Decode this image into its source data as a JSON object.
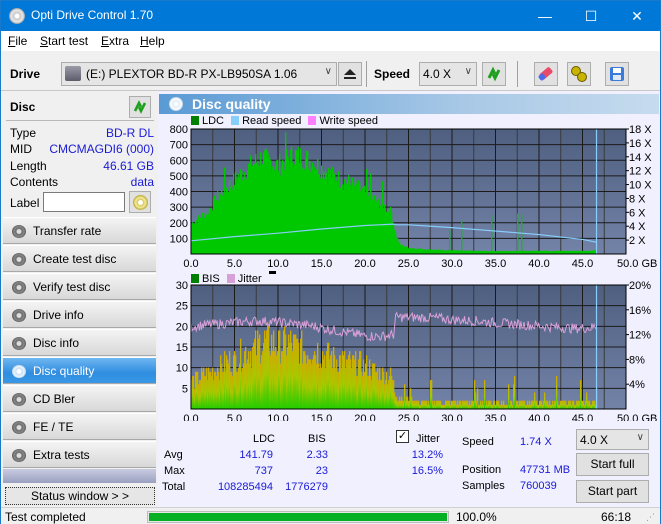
{
  "window": {
    "title": "Opti Drive Control 1.70",
    "minimize": "—",
    "maximize": "☐",
    "close": "✕"
  },
  "menu": [
    {
      "label": "File",
      "accel": "F",
      "rest": "ile"
    },
    {
      "label": "Start test",
      "accel": "S",
      "rest": "tart test"
    },
    {
      "label": "Extra",
      "accel": "E",
      "rest": "xtra"
    },
    {
      "label": "Help",
      "accel": "H",
      "rest": "elp"
    }
  ],
  "toolbar": {
    "drive_label": "Drive",
    "drive_value": "(E:)  PLEXTOR BD-R  PX-LB950SA 1.06",
    "speed_label": "Speed",
    "speed_value": "4.0 X",
    "icons": [
      "drive-icon",
      "eject-icon",
      "refresh-icon",
      "erase-icon",
      "settings-icon",
      "save-icon"
    ]
  },
  "disc": {
    "header": "Disc",
    "rows": [
      {
        "key": "Type",
        "value": "BD-R DL"
      },
      {
        "key": "MID",
        "value": "CMCMAGDI6 (000)"
      },
      {
        "key": "Length",
        "value": "46.61 GB"
      },
      {
        "key": "Contents",
        "value": "data"
      }
    ],
    "label_key": "Label",
    "label_value": ""
  },
  "nav": [
    {
      "label": "Transfer rate",
      "active": false
    },
    {
      "label": "Create test disc",
      "active": false
    },
    {
      "label": "Verify test disc",
      "active": false
    },
    {
      "label": "Drive info",
      "active": false
    },
    {
      "label": "Disc info",
      "active": false
    },
    {
      "label": "Disc quality",
      "active": true
    },
    {
      "label": "CD Bler",
      "active": false
    },
    {
      "label": "FE / TE",
      "active": false
    },
    {
      "label": "Extra tests",
      "active": false
    }
  ],
  "status_window_btn": "Status window > >",
  "panel": {
    "title": "Disc quality"
  },
  "colors": {
    "ldc": "#008000",
    "read_speed": "#87cefa",
    "write_speed": "#ff80ff",
    "bis": "#008000",
    "jitter": "#d8a0d8",
    "plot_bg_top": "#4f5f80",
    "plot_bg_bottom": "#7082a8",
    "bar_green": "#00cc00",
    "bar_yellow": "#c8c000",
    "accent": "#0078d7"
  },
  "chart_data": [
    {
      "type": "bar",
      "title": "",
      "legend": [
        "LDC",
        "Read speed",
        "Write speed"
      ],
      "legend_position": "top-left",
      "xlabel": "GB",
      "x_ticks": [
        "0.0",
        "5.0",
        "10.0",
        "15.0",
        "20.0",
        "25.0",
        "30.0",
        "35.0",
        "40.0",
        "45.0",
        "50.0 GB"
      ],
      "xlim": [
        0,
        50
      ],
      "ylim_left": [
        0,
        800
      ],
      "y_ticks_left": [
        "100",
        "200",
        "300",
        "400",
        "500",
        "600",
        "700",
        "800"
      ],
      "ylim_right": [
        0,
        18
      ],
      "y_ticks_right": [
        "2 X",
        "4 X",
        "6 X",
        "8 X",
        "10 X",
        "12 X",
        "14 X",
        "16 X",
        "18 X"
      ],
      "grid": true,
      "end_marker_gb": 46.61,
      "series": [
        {
          "name": "LDC",
          "x": [
            0,
            1,
            2,
            3,
            4,
            5,
            6,
            7,
            8,
            9,
            10,
            11,
            12,
            13,
            14,
            15,
            16,
            17,
            18,
            19,
            20,
            21,
            22,
            23,
            23.5,
            24,
            25,
            26,
            27,
            28,
            29,
            30,
            31,
            32,
            33,
            34,
            35,
            36,
            37,
            38,
            39,
            40,
            41,
            42,
            43,
            44,
            45,
            46,
            46.6
          ],
          "values": [
            200,
            240,
            290,
            370,
            430,
            490,
            540,
            590,
            630,
            610,
            580,
            630,
            650,
            630,
            600,
            560,
            520,
            490,
            470,
            440,
            400,
            360,
            320,
            270,
            120,
            60,
            40,
            35,
            30,
            28,
            25,
            25,
            22,
            22,
            20,
            20,
            20,
            20,
            20,
            20,
            20,
            22,
            20,
            20,
            20,
            20,
            20,
            22,
            30
          ]
        },
        {
          "name": "Read speed",
          "x": [
            0,
            5,
            10,
            15,
            20,
            23.3,
            23.5,
            25,
            30,
            35,
            40,
            45,
            46.6
          ],
          "values": [
            1.9,
            2.5,
            3.0,
            3.6,
            4.1,
            4.3,
            4.2,
            4.2,
            3.8,
            3.3,
            2.8,
            2.1,
            1.7
          ]
        },
        {
          "name": "Write speed",
          "x": [],
          "values": []
        }
      ]
    },
    {
      "type": "bar",
      "title": "",
      "legend": [
        "BIS",
        "Jitter"
      ],
      "legend_position": "top-left",
      "xlabel": "GB",
      "x_ticks": [
        "0.0",
        "5.0",
        "10.0",
        "15.0",
        "20.0",
        "25.0",
        "30.0",
        "35.0",
        "40.0",
        "45.0",
        "50.0 GB"
      ],
      "xlim": [
        0,
        50
      ],
      "ylim_left": [
        0,
        30
      ],
      "y_ticks_left": [
        "5",
        "10",
        "15",
        "20",
        "25",
        "30"
      ],
      "ylim_right": [
        0,
        20
      ],
      "y_ticks_right": [
        "4%",
        "8%",
        "12%",
        "16%",
        "20%"
      ],
      "grid": true,
      "end_marker_gb": 46.61,
      "series": [
        {
          "name": "BIS",
          "x": [
            0,
            1,
            2,
            3,
            4,
            5,
            6,
            7,
            8,
            9,
            10,
            11,
            12,
            13,
            14,
            15,
            16,
            17,
            18,
            19,
            20,
            21,
            22,
            23,
            23.5,
            24,
            25,
            26,
            27,
            28,
            29,
            30,
            31,
            32,
            33,
            34,
            35,
            36,
            37,
            38,
            39,
            40,
            41,
            42,
            43,
            44,
            45,
            46,
            46.6
          ],
          "values": [
            8,
            9,
            10,
            12,
            13,
            14,
            16,
            17,
            19,
            19,
            18,
            19,
            18,
            17,
            17,
            16,
            15,
            14,
            13,
            13,
            12,
            11,
            10,
            9,
            4,
            3,
            3,
            2,
            2,
            2,
            2,
            2,
            2,
            2,
            2,
            2,
            2,
            2,
            2,
            2,
            2,
            2,
            2,
            2,
            2,
            2,
            2,
            2,
            2
          ]
        },
        {
          "name": "Jitter",
          "x": [
            0,
            2,
            4,
            6,
            8,
            10,
            12,
            14,
            16,
            18,
            20,
            22,
            23.3,
            23.5,
            25,
            28,
            30,
            33,
            35,
            38,
            40,
            42,
            44,
            46,
            46.6
          ],
          "values": [
            13.3,
            13.6,
            13.8,
            14.1,
            14.2,
            14.0,
            13.7,
            13.4,
            12.8,
            12.3,
            11.8,
            11.7,
            12.0,
            14.8,
            14.8,
            14.7,
            14.4,
            14.2,
            13.9,
            13.6,
            13.4,
            13.2,
            13.0,
            13.1,
            13.4
          ]
        }
      ]
    }
  ],
  "stats": {
    "col_ldc": "LDC",
    "col_bis": "BIS",
    "jitter_label": "Jitter",
    "jitter_checked": true,
    "rows": [
      {
        "label": "Avg",
        "ldc": "141.79",
        "bis": "2.33",
        "jitter": "13.2%"
      },
      {
        "label": "Max",
        "ldc": "737",
        "bis": "23",
        "jitter": "16.5%"
      },
      {
        "label": "Total",
        "ldc": "108285494",
        "bis": "1776279",
        "jitter": ""
      }
    ],
    "speed_label": "Speed",
    "speed_value": "1.74 X",
    "position_label": "Position",
    "position_value": "47731 MB",
    "samples_label": "Samples",
    "samples_value": "760039",
    "speed_select": "4.0 X",
    "start_full": "Start full",
    "start_part": "Start part"
  },
  "statusbar": {
    "text": "Test completed",
    "progress_percent": 100.0,
    "progress_label": "100.0%",
    "time": "66:18"
  }
}
